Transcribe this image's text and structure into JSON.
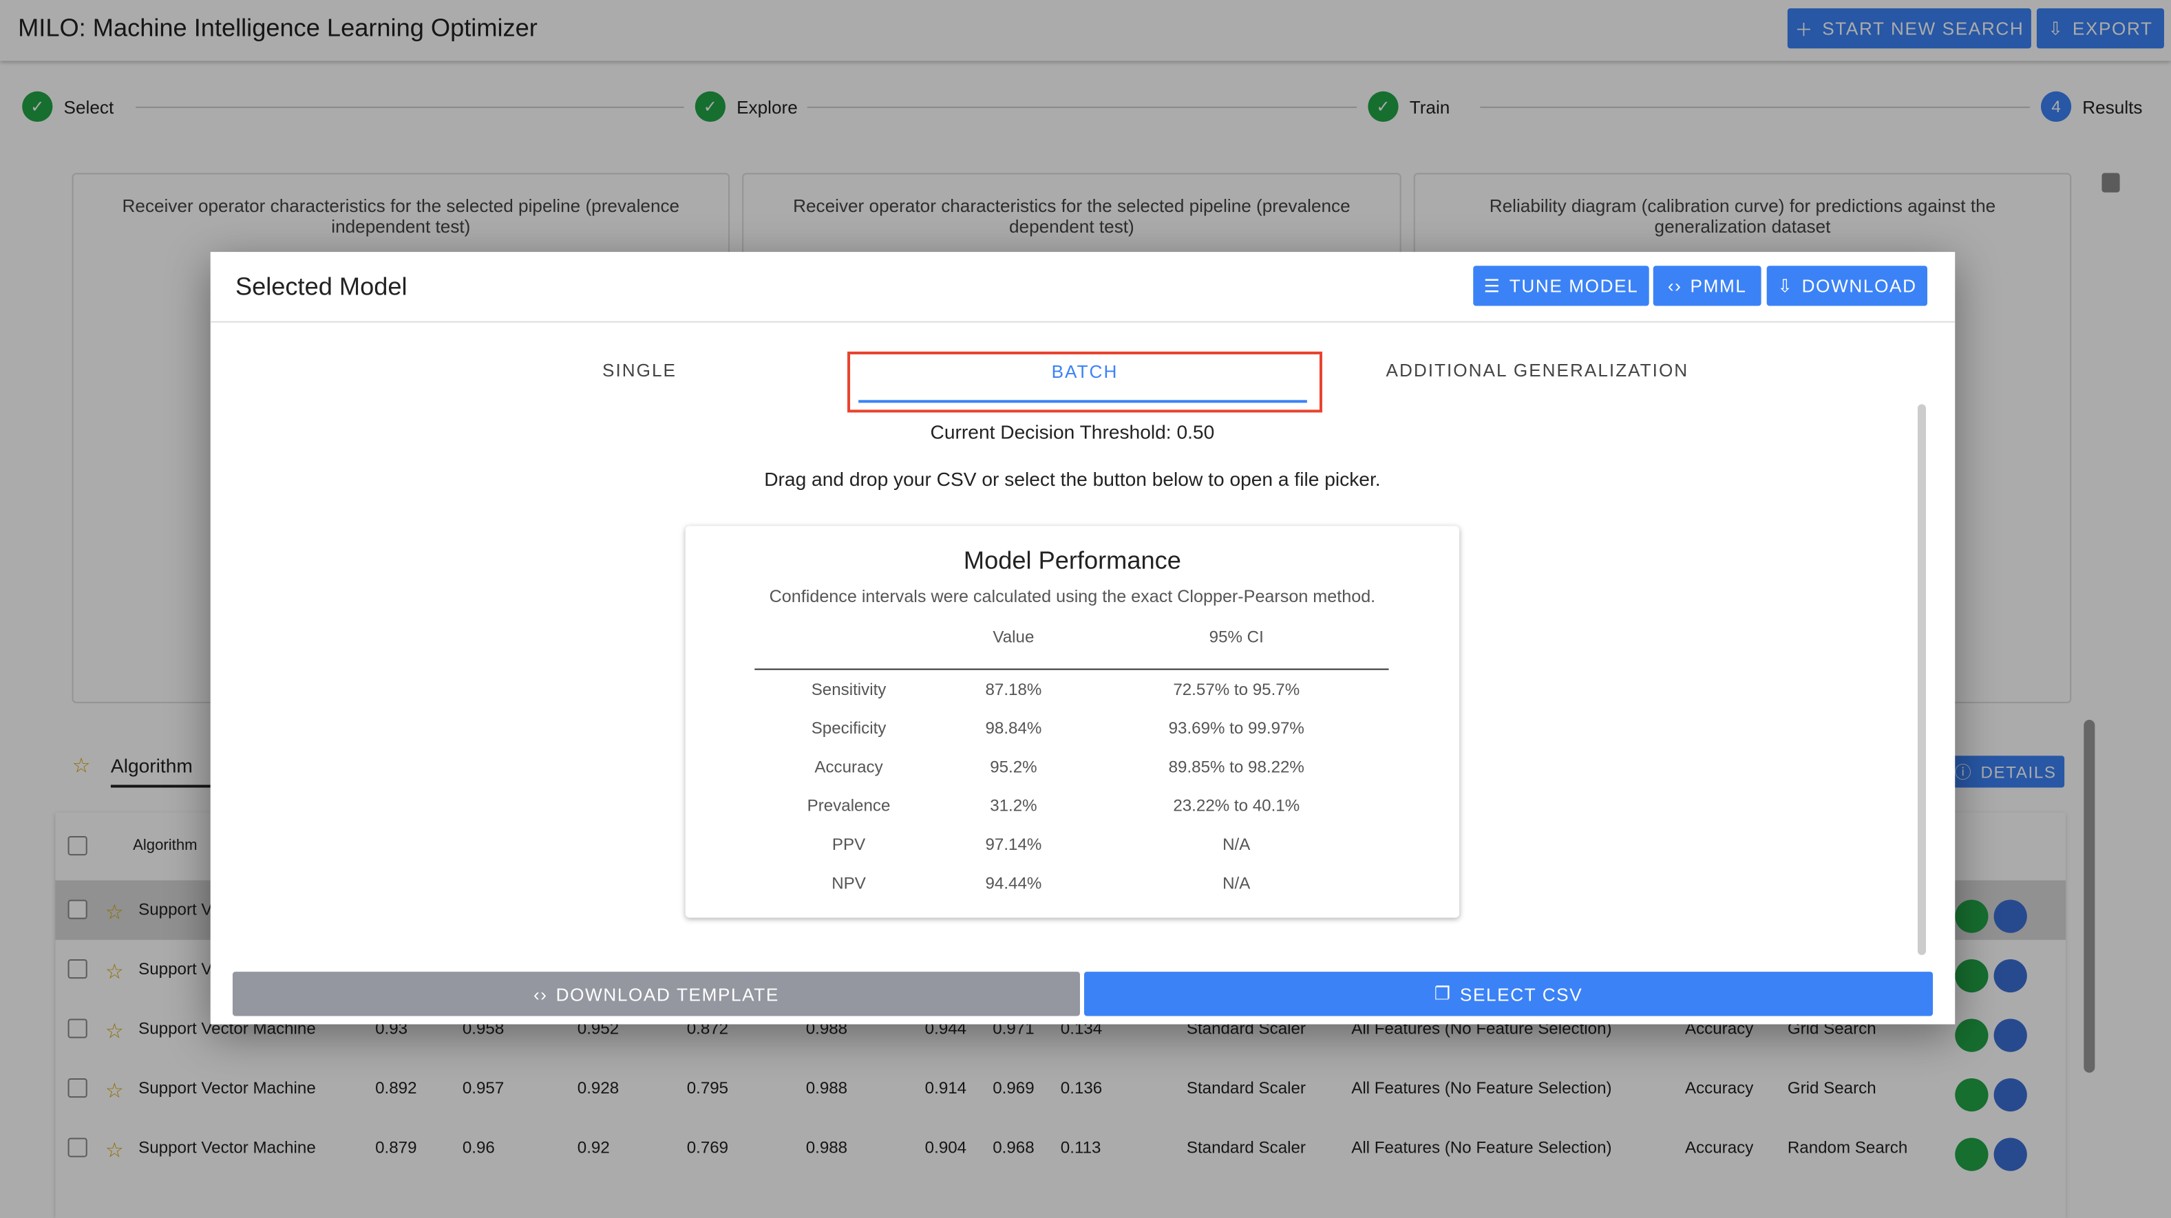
{
  "app": {
    "title": "MILO: Machine Intelligence Learning Optimizer",
    "start_new_search": "START NEW SEARCH",
    "export": "EXPORT"
  },
  "steps": [
    {
      "label": "Select"
    },
    {
      "label": "Explore"
    },
    {
      "label": "Train"
    },
    {
      "label": "Results",
      "number": "4"
    }
  ],
  "cards": [
    {
      "caption": "Receiver operator characteristics for the selected pipeline (prevalence independent test)"
    },
    {
      "caption": "Receiver operator characteristics for the selected pipeline (prevalence dependent test)"
    },
    {
      "caption": "Reliability diagram (calibration curve) for predictions against the generalization dataset"
    }
  ],
  "results": {
    "tab": "Algorithm",
    "details": "DETAILS",
    "header_algorithm": "Algorithm",
    "rows": [
      [
        "Support Vector Machine",
        "",
        "",
        "",
        "",
        "",
        "",
        "",
        "",
        "",
        "",
        "",
        ""
      ],
      [
        "Support Vector Machine",
        "",
        "",
        "",
        "",
        "",
        "",
        "",
        "",
        "",
        "",
        "",
        ""
      ],
      [
        "Support Vector Machine",
        "0.93",
        "0.958",
        "0.952",
        "0.872",
        "0.988",
        "0.944",
        "0.971",
        "0.134",
        "Standard Scaler",
        "All Features (No Feature Selection)",
        "Accuracy",
        "Grid Search"
      ],
      [
        "Support Vector Machine",
        "0.892",
        "0.957",
        "0.928",
        "0.795",
        "0.988",
        "0.914",
        "0.969",
        "0.136",
        "Standard Scaler",
        "All Features (No Feature Selection)",
        "Accuracy",
        "Grid Search"
      ],
      [
        "Support Vector Machine",
        "0.879",
        "0.96",
        "0.92",
        "0.769",
        "0.988",
        "0.904",
        "0.968",
        "0.113",
        "Standard Scaler",
        "All Features (No Feature Selection)",
        "Accuracy",
        "Random Search"
      ]
    ]
  },
  "modal": {
    "title": "Selected Model",
    "tune": "TUNE MODEL",
    "pmml": "PMML",
    "download": "DOWNLOAD",
    "tabs": [
      "SINGLE",
      "BATCH",
      "ADDITIONAL GENERALIZATION"
    ],
    "active_tab": "BATCH",
    "threshold": "Current Decision Threshold: 0.50",
    "instructions": "Drag and drop your CSV or select the button below to open a file picker.",
    "performance": {
      "title": "Model Performance",
      "subtitle": "Confidence intervals were calculated using the exact Clopper-Pearson method.",
      "headers": [
        "",
        "Value",
        "95% CI"
      ],
      "rows": [
        [
          "Sensitivity",
          "87.18%",
          "72.57% to 95.7%"
        ],
        [
          "Specificity",
          "98.84%",
          "93.69% to 99.97%"
        ],
        [
          "Accuracy",
          "95.2%",
          "89.85% to 98.22%"
        ],
        [
          "Prevalence",
          "31.2%",
          "23.22% to 40.1%"
        ],
        [
          "PPV",
          "97.14%",
          "N/A"
        ],
        [
          "NPV",
          "94.44%",
          "N/A"
        ]
      ]
    },
    "download_template": "DOWNLOAD TEMPLATE",
    "select_csv": "SELECT CSV"
  },
  "colors": {
    "primary": "#3b82f6",
    "success": "#22a447",
    "highlight": "#e8432e"
  }
}
